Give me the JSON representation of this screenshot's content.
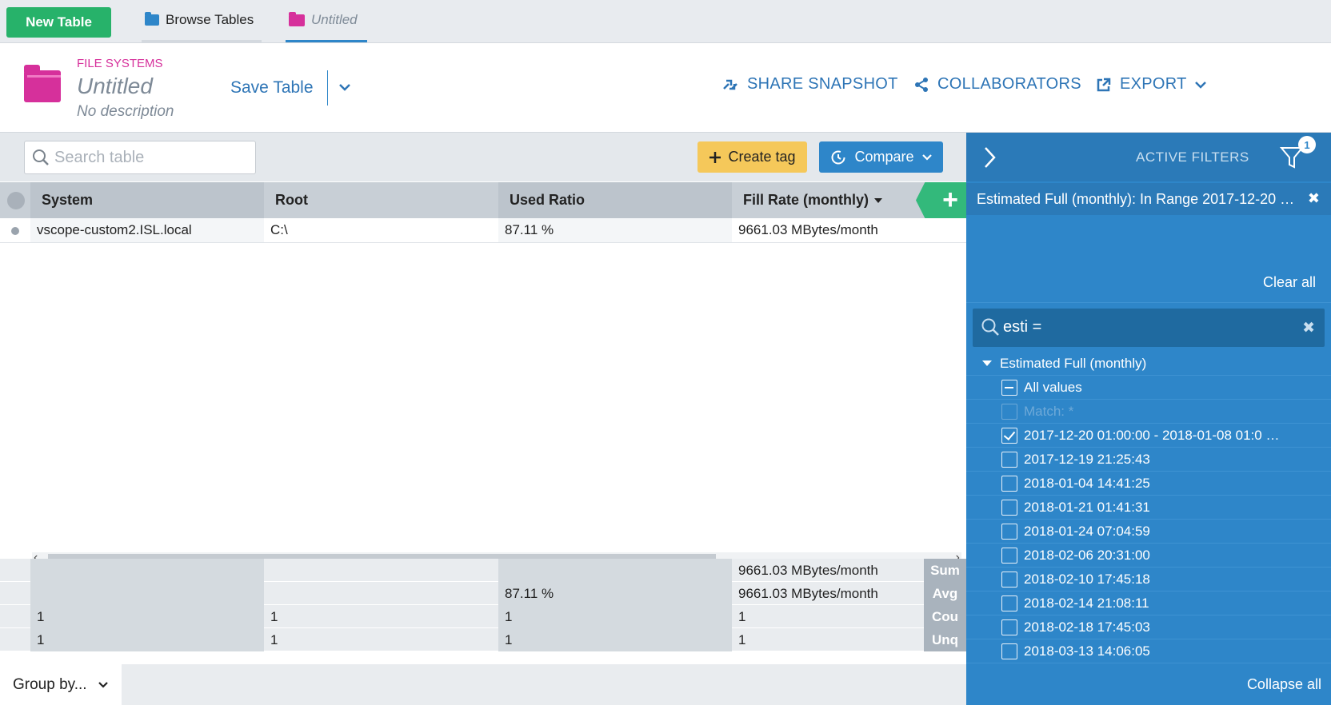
{
  "tabbar": {
    "new_table_label": "New Table",
    "tabs": [
      {
        "label": "Browse Tables",
        "icon": "folder-icon"
      },
      {
        "label": "Untitled",
        "icon": "folder-icon"
      }
    ]
  },
  "header": {
    "category": "FILE SYSTEMS",
    "title": "Untitled",
    "description": "No description",
    "save_label": "Save Table",
    "share_label": "SHARE SNAPSHOT",
    "collaborators_label": "COLLABORATORS",
    "export_label": "EXPORT"
  },
  "toolbar": {
    "search_placeholder": "Search table",
    "create_tag_label": "Create tag",
    "compare_label": "Compare"
  },
  "table": {
    "columns": [
      "System",
      "Root",
      "Used Ratio",
      "Fill Rate (monthly)"
    ],
    "rows": [
      {
        "system": "vscope-custom2.ISL.local",
        "root": "C:\\",
        "used_ratio": "87.11 %",
        "fill_rate": "9661.03 MBytes/month"
      }
    ],
    "aggregates": {
      "sum": {
        "label": "Sum",
        "system": "",
        "root": "",
        "used_ratio": "",
        "fill_rate": "9661.03 MBytes/month"
      },
      "avg": {
        "label": "Avg",
        "system": "",
        "root": "",
        "used_ratio": "87.11 %",
        "fill_rate": "9661.03 MBytes/month"
      },
      "count": {
        "label": "Cou",
        "system": "1",
        "root": "1",
        "used_ratio": "1",
        "fill_rate": "1"
      },
      "unique": {
        "label": "Unq",
        "system": "1",
        "root": "1",
        "used_ratio": "1",
        "fill_rate": "1"
      }
    },
    "group_by_label": "Group by..."
  },
  "filters": {
    "title": "ACTIVE FILTERS",
    "badge_count": "1",
    "active_filter": "Estimated Full (monthly): In Range 2017-12-20 …",
    "clear_all_label": "Clear all",
    "search_value": "esti =",
    "group_label": "Estimated Full (monthly)",
    "items": [
      {
        "label": "All values",
        "state": "partial"
      },
      {
        "label": "Match: *",
        "state": "disabled"
      },
      {
        "label": "2017-12-20 01:00:00 - 2018-01-08 01:0 …",
        "state": "checked"
      },
      {
        "label": "2017-12-19 21:25:43",
        "state": "unchecked"
      },
      {
        "label": "2018-01-04 14:41:25",
        "state": "unchecked"
      },
      {
        "label": "2018-01-21 01:41:31",
        "state": "unchecked"
      },
      {
        "label": "2018-01-24 07:04:59",
        "state": "unchecked"
      },
      {
        "label": "2018-02-06 20:31:00",
        "state": "unchecked"
      },
      {
        "label": "2018-02-10 17:45:18",
        "state": "unchecked"
      },
      {
        "label": "2018-02-14 21:08:11",
        "state": "unchecked"
      },
      {
        "label": "2018-02-18 17:45:03",
        "state": "unchecked"
      },
      {
        "label": "2018-03-13 14:06:05",
        "state": "unchecked"
      }
    ],
    "collapse_all_label": "Collapse all"
  },
  "colors": {
    "accent": "#2e86c9",
    "new_button": "#27b26a",
    "category_pink": "#d6309b",
    "tag_yellow": "#f5c85a"
  }
}
